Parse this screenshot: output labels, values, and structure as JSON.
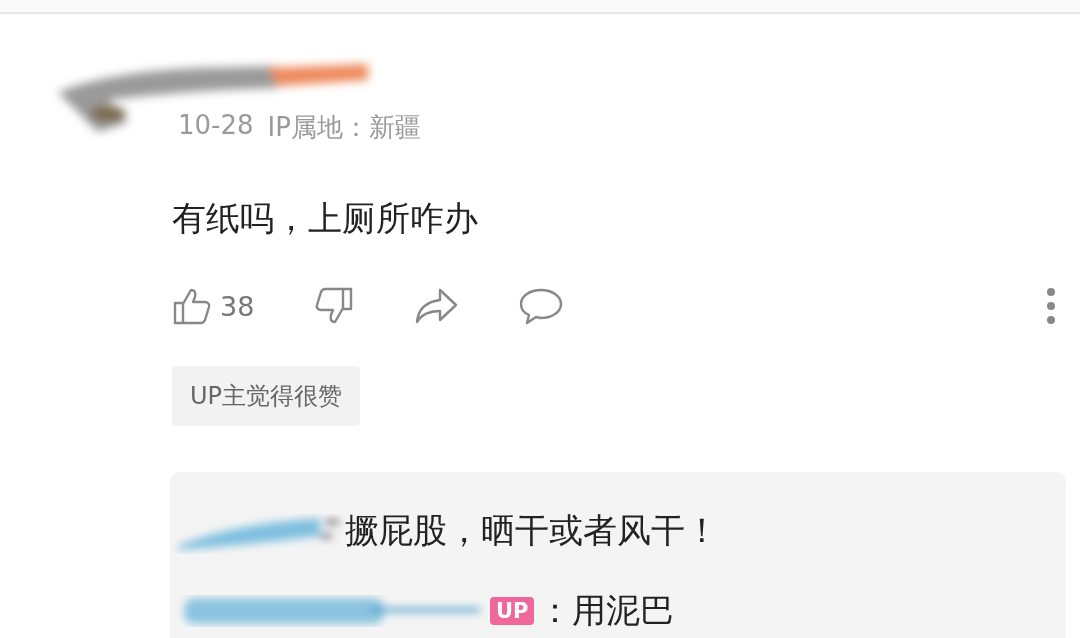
{
  "comment": {
    "date": "10-28",
    "ip_location": "IP属地：新疆",
    "text": "有纸吗，上厕所咋办",
    "likes": "38",
    "up_liked_tag": "UP主觉得很赞"
  },
  "replies": [
    {
      "is_up": false,
      "text": "撅屁股，晒干或者风干！"
    },
    {
      "is_up": true,
      "badge": "UP",
      "text": "：用泥巴"
    }
  ]
}
